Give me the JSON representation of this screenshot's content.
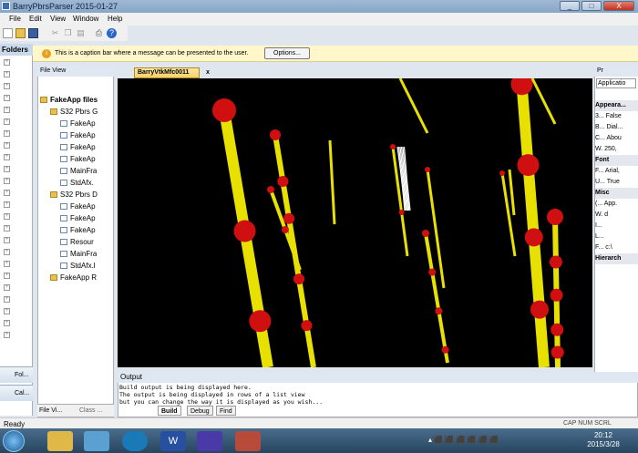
{
  "window": {
    "title": "BarryPbrsParser 2015-01-27",
    "min_label": "_",
    "max_label": "□",
    "close_label": "X"
  },
  "menu": [
    "File",
    "Edit",
    "View",
    "Window",
    "Help"
  ],
  "folders_panel": {
    "title": "Folders",
    "buttons": [
      "Fol...",
      "Cal..."
    ]
  },
  "infobar": {
    "text": "This is a caption bar where a message can be presented to the user.",
    "button": "Options..."
  },
  "file_view": {
    "title": "File View",
    "items": [
      {
        "label": "FakeApp files",
        "type": "folder",
        "indent": 0
      },
      {
        "label": "S32 Pbrs G",
        "type": "folder",
        "indent": 1
      },
      {
        "label": "FakeAp",
        "type": "file",
        "indent": 2
      },
      {
        "label": "FakeAp",
        "type": "file",
        "indent": 2
      },
      {
        "label": "FakeAp",
        "type": "file",
        "indent": 2
      },
      {
        "label": "FakeAp",
        "type": "file",
        "indent": 2
      },
      {
        "label": "MainFra",
        "type": "file",
        "indent": 2
      },
      {
        "label": "StdAfx.",
        "type": "file",
        "indent": 2
      },
      {
        "label": "S32 Pbrs D",
        "type": "folder",
        "indent": 1
      },
      {
        "label": "FakeAp",
        "type": "file",
        "indent": 2
      },
      {
        "label": "FakeAp",
        "type": "file",
        "indent": 2
      },
      {
        "label": "FakeAp",
        "type": "file",
        "indent": 2
      },
      {
        "label": "Resour",
        "type": "file",
        "indent": 2
      },
      {
        "label": "MainFra",
        "type": "file",
        "indent": 2
      },
      {
        "label": "StdAfx.l",
        "type": "file",
        "indent": 2
      },
      {
        "label": "FakeApp R",
        "type": "folder",
        "indent": 1
      }
    ],
    "tabs": [
      "File Vi...",
      "Class ..."
    ]
  },
  "document": {
    "tab": "BarryVtkMfc0011",
    "close": "x"
  },
  "properties": {
    "title": "Pr",
    "dropdown": "Applicatio",
    "rows": [
      {
        "text": "Appeara...",
        "cat": true
      },
      {
        "text": "3... False",
        "cat": false
      },
      {
        "text": "B... Dial...",
        "cat": false
      },
      {
        "text": "C... Abou",
        "cat": false
      },
      {
        "text": "W. 250,",
        "cat": false
      },
      {
        "text": "Font",
        "cat": true
      },
      {
        "text": "F... Arial,",
        "cat": false
      },
      {
        "text": "U... True",
        "cat": false
      },
      {
        "text": "Misc",
        "cat": true
      },
      {
        "text": "(... App.",
        "cat": false
      },
      {
        "text": "W. d",
        "cat": false
      },
      {
        "text": "I...",
        "cat": false
      },
      {
        "text": "L...",
        "cat": false
      },
      {
        "text": "F... c:\\",
        "cat": false
      },
      {
        "text": "Hierarch",
        "cat": true
      }
    ]
  },
  "output": {
    "title": "Output",
    "lines": [
      "Build output is being displayed here.",
      "The output is being displayed in rows of a list view",
      "but you can change the way it is displayed as you wish..."
    ],
    "tabs": [
      "Build",
      "Debug",
      "Find"
    ]
  },
  "status": {
    "left": "Ready",
    "right": "CAP  NUM  SCRL"
  },
  "clock": {
    "time": "20:12",
    "date": "2015/3/28"
  }
}
